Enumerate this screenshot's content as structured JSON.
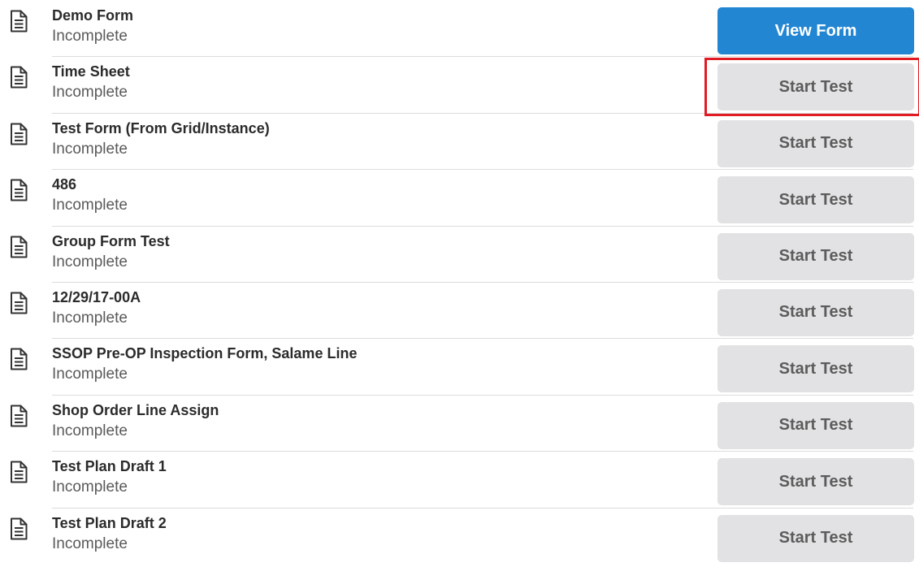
{
  "forms": [
    {
      "name": "Demo Form",
      "status": "Incomplete",
      "action_label": "View Form",
      "action_style": "primary"
    },
    {
      "name": "Time Sheet",
      "status": "Incomplete",
      "action_label": "Start Test",
      "action_style": "secondary"
    },
    {
      "name": "Test Form (From Grid/Instance)",
      "status": "Incomplete",
      "action_label": "Start Test",
      "action_style": "secondary"
    },
    {
      "name": "486",
      "status": "Incomplete",
      "action_label": "Start Test",
      "action_style": "secondary"
    },
    {
      "name": "Group Form Test",
      "status": "Incomplete",
      "action_label": "Start Test",
      "action_style": "secondary"
    },
    {
      "name": "12/29/17-00A",
      "status": "Incomplete",
      "action_label": "Start Test",
      "action_style": "secondary"
    },
    {
      "name": "SSOP Pre-OP Inspection Form, Salame Line",
      "status": "Incomplete",
      "action_label": "Start Test",
      "action_style": "secondary"
    },
    {
      "name": "Shop Order Line Assign",
      "status": "Incomplete",
      "action_label": "Start Test",
      "action_style": "secondary"
    },
    {
      "name": "Test Plan Draft 1",
      "status": "Incomplete",
      "action_label": "Start Test",
      "action_style": "secondary"
    },
    {
      "name": "Test Plan Draft 2",
      "status": "Incomplete",
      "action_label": "Start Test",
      "action_style": "secondary"
    }
  ],
  "icons": {
    "row_icon": "document-icon"
  },
  "colors": {
    "primary_button": "#2386d3",
    "secondary_button": "#e2e2e4",
    "highlight_border": "#e01b22"
  }
}
